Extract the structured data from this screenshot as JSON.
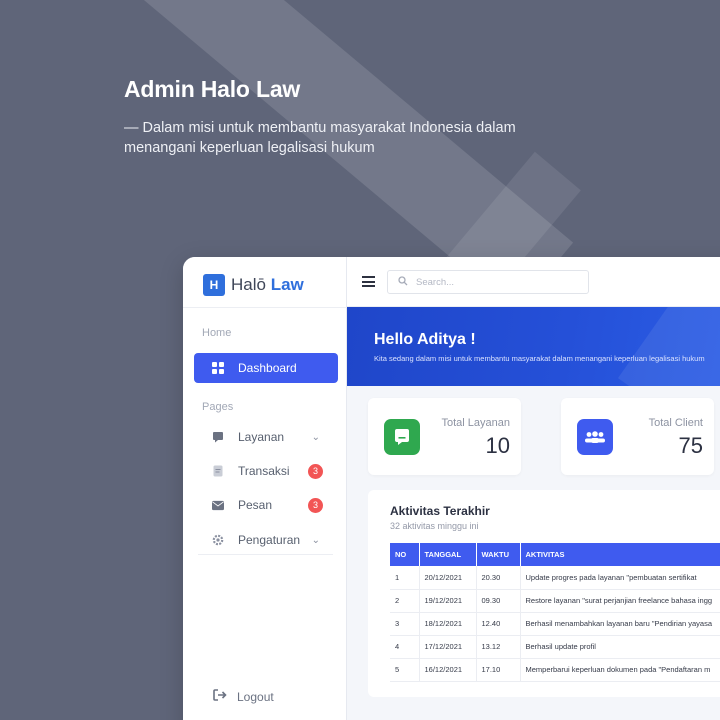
{
  "hero": {
    "title": "Admin Halo Law",
    "subtitle": "— Dalam misi untuk membantu masyarakat Indonesia dalam menangani keperluan legalisasi hukum"
  },
  "logo": {
    "mark": "H",
    "text_plain": "Halō",
    "text_bold": "Law"
  },
  "sidebar": {
    "home_label": "Home",
    "pages_label": "Pages",
    "items": [
      {
        "label": "Dashboard",
        "icon": "grid-icon",
        "active": true
      },
      {
        "label": "Layanan",
        "icon": "chat-icon",
        "chevron": true
      },
      {
        "label": "Transaksi",
        "icon": "document-icon",
        "badge": "3"
      },
      {
        "label": "Pesan",
        "icon": "mail-icon",
        "badge": "3"
      },
      {
        "label": "Pengaturan",
        "icon": "gear-icon",
        "chevron": true
      }
    ],
    "logout_label": "Logout"
  },
  "topbar": {
    "search_placeholder": "Search..."
  },
  "banner": {
    "title": "Hello Aditya !",
    "subtitle": "Kita sedang dalam misi untuk membantu masyarakat dalam menangani keperluan legalisasi hukum"
  },
  "stats": [
    {
      "label": "Total Layanan",
      "value": "10",
      "color": "#2fa84f",
      "icon": "chat-icon"
    },
    {
      "label": "Total Client",
      "value": "75",
      "color": "#3f5bef",
      "icon": "users-icon"
    }
  ],
  "activity": {
    "title": "Aktivitas Terakhir",
    "subtitle": "32 aktivitas minggu ini",
    "columns": [
      "NO",
      "TANGGAL",
      "WAKTU",
      "AKTIVITAS"
    ],
    "rows": [
      [
        "1",
        "20/12/2021",
        "20.30",
        "Update progres pada layanan \"pembuatan sertifikat"
      ],
      [
        "2",
        "19/12/2021",
        "09.30",
        "Restore layanan \"surat perjanjian freelance bahasa ingg"
      ],
      [
        "3",
        "18/12/2021",
        "12.40",
        "Berhasil menambahkan layanan baru \"Pendirian yayasa"
      ],
      [
        "4",
        "17/12/2021",
        "13.12",
        "Berhasil update profil"
      ],
      [
        "5",
        "16/12/2021",
        "17.10",
        "Memperbarui keperluan dokumen pada \"Pendaftaran m"
      ]
    ]
  },
  "colors": {
    "accent": "#3f5bef",
    "badge": "#f25555",
    "background": "#5f6579"
  }
}
